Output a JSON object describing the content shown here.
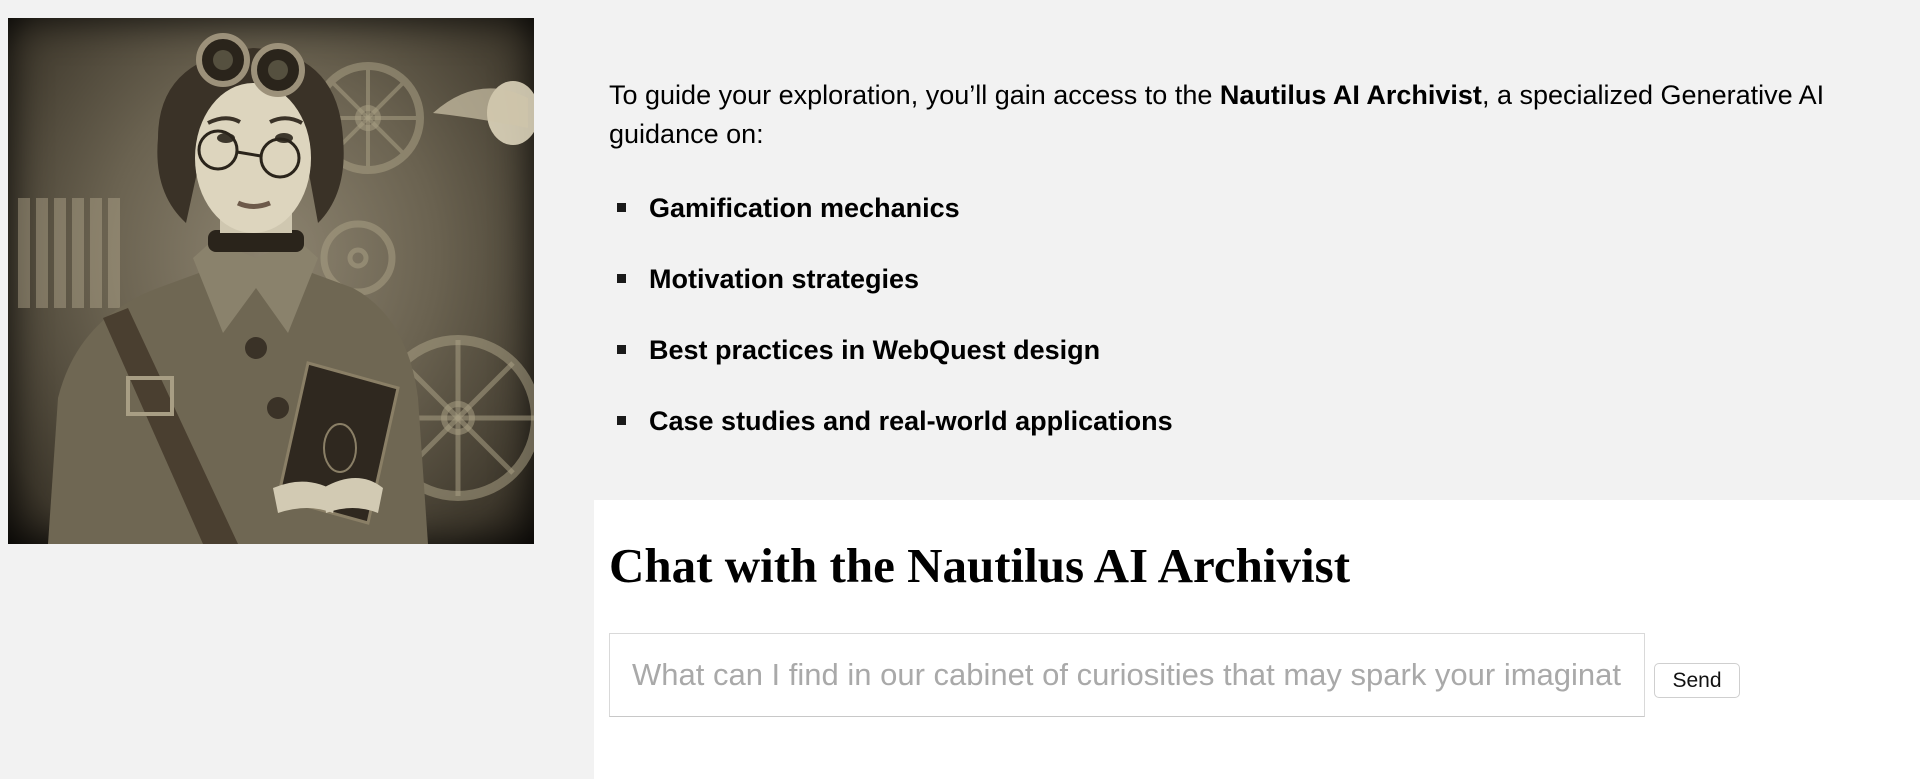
{
  "intro": {
    "text_before": "To guide your exploration, you’ll gain access to the ",
    "highlight": "Nautilus AI Archivist",
    "text_after": ", a specialized Generative AI",
    "line2": "guidance on:"
  },
  "topics": [
    "Gamification mechanics",
    "Motivation strategies",
    "Best practices in WebQuest design",
    "Case studies and real-world applications"
  ],
  "chat": {
    "title": "Chat with the Nautilus AI Archivist",
    "input_placeholder": "What can I find in our cabinet of curiosities that may spark your imagination?",
    "input_value": "",
    "send_label": "Send"
  },
  "colors": {
    "page_background": "#f2f2f2",
    "panel_background": "#ffffff",
    "sepia_dark": "#2a241b",
    "sepia_light": "#d8cfb6"
  }
}
